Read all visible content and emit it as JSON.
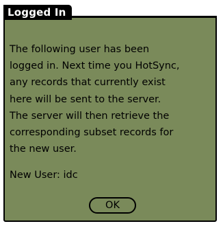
{
  "dialog": {
    "title": "Logged In",
    "message_lines": [
      "The following user has been",
      "logged in.  Next time you HotSync,",
      "any records that currently exist",
      "here will be sent to the server.",
      "The server will then retrieve the",
      "corresponding subset records for",
      "the new user."
    ],
    "new_user_label": "New User:",
    "new_user_value": "idc",
    "ok_label": "OK"
  },
  "colors": {
    "dialog_background": "#7a8a5a",
    "title_background": "#000000",
    "title_text": "#ffffff"
  }
}
